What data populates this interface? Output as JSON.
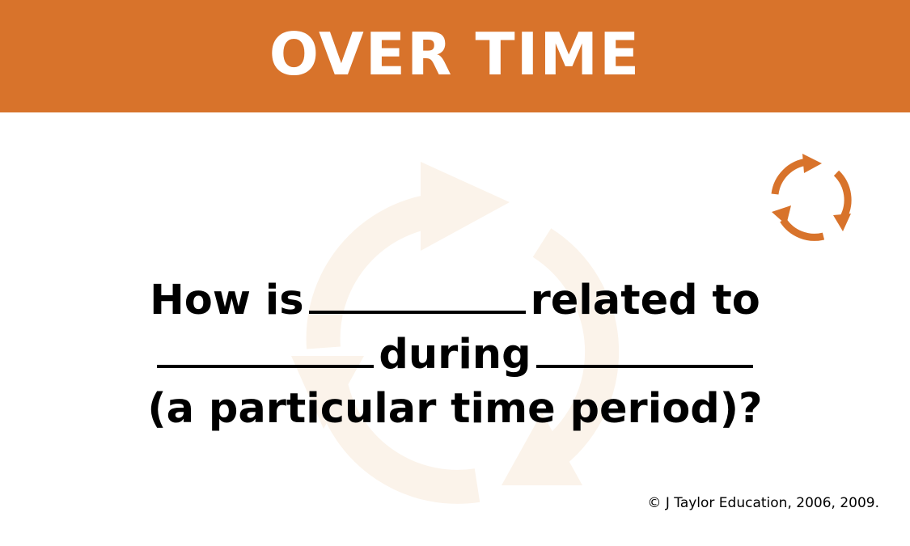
{
  "header": {
    "title": "OVER TIME",
    "band_color": "#D8732B"
  },
  "icons": {
    "corner": "cycle-arrows-icon",
    "watermark": "cycle-arrows-watermark-icon",
    "accent_color": "#D8732B",
    "watermark_color": "#FBF3EA"
  },
  "question": {
    "line1_start": "How is",
    "line1_end": "related to",
    "line2_middle": "during",
    "line3": "(a particular time period)?"
  },
  "footer": {
    "copyright": "© J Taylor Education, 2006, 2009."
  }
}
